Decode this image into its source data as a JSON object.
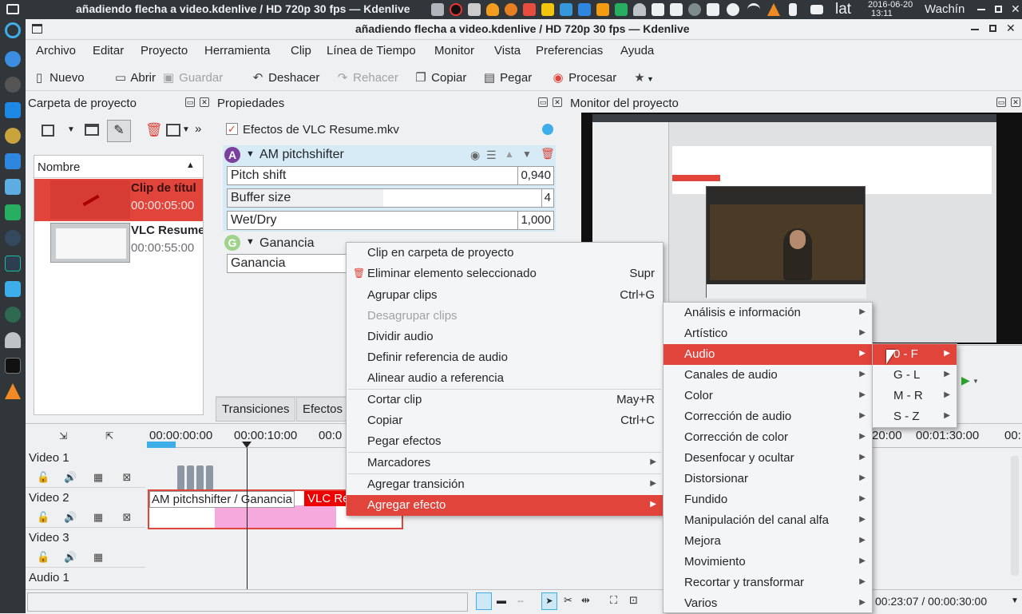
{
  "system_bar": {
    "title": "añadiendo flecha a video.kdenlive / HD 720p 30 fps — Kdenlive",
    "keyboard": "lat",
    "date": "2016-06-20",
    "time": "13:11",
    "user": "Wachín"
  },
  "window": {
    "title": "añadiendo flecha a video.kdenlive / HD 720p 30 fps — Kdenlive"
  },
  "menubar": [
    "Archivo",
    "Editar",
    "Proyecto",
    "Herramienta",
    "Clip",
    "Línea de Tiempo",
    "Monitor",
    "Vista",
    "Preferencias",
    "Ayuda"
  ],
  "toolbar": {
    "nuevo": "Nuevo",
    "abrir": "Abrir",
    "guardar": "Guardar",
    "deshacer": "Deshacer",
    "rehacer": "Rehacer",
    "copiar": "Copiar",
    "pegar": "Pegar",
    "procesar": "Procesar"
  },
  "project_bin": {
    "title": "Carpeta de proyecto",
    "column": "Nombre",
    "clips": [
      {
        "name": "Clip de títul",
        "duration": "00:00:05:00"
      },
      {
        "name": "VLC Resume",
        "duration": "00:00:55:00"
      }
    ]
  },
  "properties": {
    "title": "Propiedades",
    "clip_effects": "Efectos de VLC Resume.mkv",
    "effect1": {
      "badge": "A",
      "name": "AM pitchshifter",
      "params": [
        {
          "label": "Pitch shift",
          "value": "0,940"
        },
        {
          "label": "Buffer size",
          "value": "4"
        },
        {
          "label": "Wet/Dry",
          "value": "1,000"
        }
      ]
    },
    "effect2": {
      "badge": "G",
      "name": "Ganancia",
      "param": "Ganancia"
    },
    "tabs": [
      "Transiciones",
      "Efectos"
    ]
  },
  "monitor": {
    "title": "Monitor del proyecto",
    "timecode": "00:23:07 / 00:00:30:00"
  },
  "timeline": {
    "ruler": [
      "00:00:00:00",
      "00:00:10:00",
      "00:0",
      "20:00",
      "00:01:30:00",
      "00:"
    ],
    "tracks": [
      "Video 1",
      "Video 2",
      "Video 3",
      "Audio 1"
    ],
    "clip_labels": [
      "AM pitchshifter / Ganancia",
      "VLC Re"
    ]
  },
  "context_menu": [
    {
      "label": "Clip en carpeta de proyecto",
      "shortcut": ""
    },
    {
      "label": "Eliminar elemento seleccionado",
      "shortcut": "Supr"
    },
    {
      "label": "Agrupar clips",
      "shortcut": "Ctrl+G"
    },
    {
      "label": "Desagrupar clips",
      "shortcut": ""
    },
    {
      "label": "Dividir audio",
      "shortcut": ""
    },
    {
      "label": "Definir referencia de audio",
      "shortcut": ""
    },
    {
      "label": "Alinear audio a referencia",
      "shortcut": ""
    },
    {
      "label": "Cortar clip",
      "shortcut": "May+R"
    },
    {
      "label": "Copiar",
      "shortcut": "Ctrl+C"
    },
    {
      "label": "Pegar efectos",
      "shortcut": ""
    },
    {
      "label": "Marcadores",
      "shortcut": ""
    },
    {
      "label": "Agregar transición",
      "shortcut": ""
    },
    {
      "label": "Agregar efecto",
      "shortcut": ""
    }
  ],
  "effects_menu": [
    "Análisis e información",
    "Artístico",
    "Audio",
    "Canales de audio",
    "Color",
    "Corrección de audio",
    "Corrección de color",
    "Desenfocar y ocultar",
    "Distorsionar",
    "Fundido",
    "Manipulación del canal alfa",
    "Mejora",
    "Movimiento",
    "Recortar y transformar",
    "Varios"
  ],
  "audio_submenu": [
    "0 - F",
    "G - L",
    "M - R",
    "S - Z"
  ],
  "colors": {
    "accent": "#e0443b",
    "dark": "#31363b",
    "highlight_blue": "#3daee9"
  }
}
